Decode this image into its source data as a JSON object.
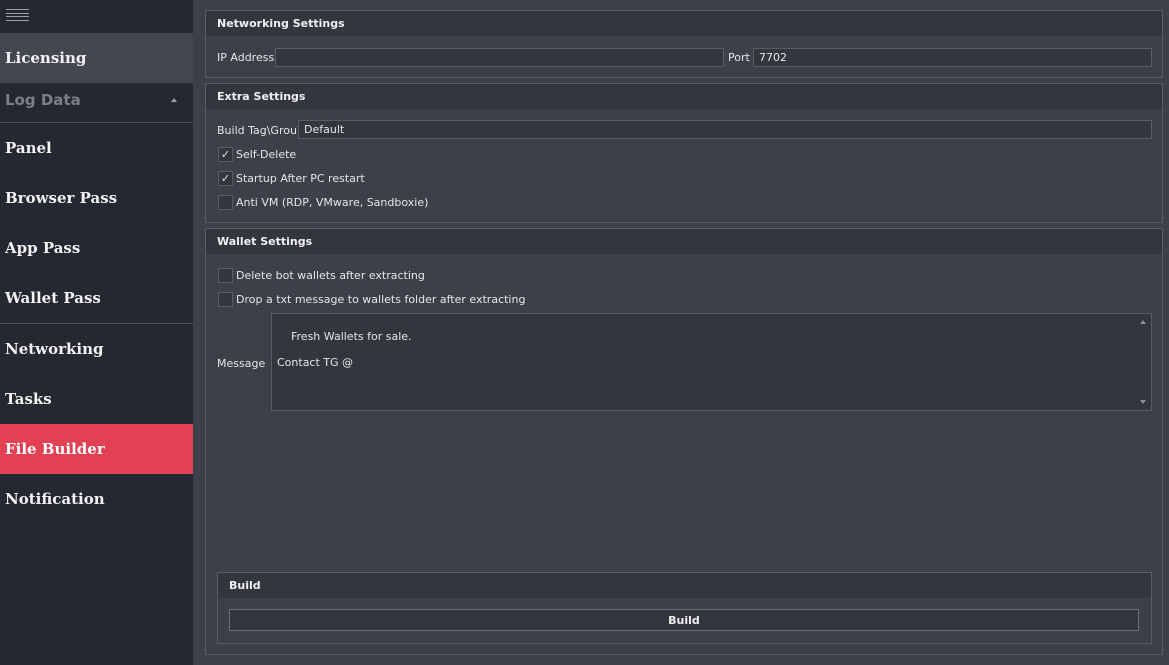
{
  "sidebar": {
    "items": [
      {
        "label": "Licensing"
      },
      {
        "label": "Log Data"
      },
      {
        "label": "Panel"
      },
      {
        "label": "Browser Pass"
      },
      {
        "label": "App Pass"
      },
      {
        "label": "Wallet Pass"
      },
      {
        "label": "Networking"
      },
      {
        "label": "Tasks"
      },
      {
        "label": "File Builder"
      },
      {
        "label": "Notification"
      }
    ],
    "active_color": "#e14152"
  },
  "networking": {
    "title": "Networking Settings",
    "ip_label": "IP Address",
    "ip_value": "",
    "port_label": "Port",
    "port_value": "7702"
  },
  "extra": {
    "title": "Extra Settings",
    "tag_label": "Build Tag\\Group",
    "tag_value": "Default",
    "self_delete": {
      "label": "Self-Delete",
      "mark": "✓"
    },
    "startup": {
      "label": "Startup After PC restart",
      "mark": "✓"
    },
    "anti_vm": {
      "label": "Anti VM (RDP, VMware, Sandboxie)",
      "mark": ""
    }
  },
  "wallet": {
    "title": "Wallet Settings",
    "delete_wallets": {
      "label": "Delete bot wallets after extracting",
      "mark": ""
    },
    "drop_txt": {
      "label": "Drop a txt message to wallets folder after extracting",
      "mark": ""
    },
    "message_label": "Message",
    "message_value": "Fresh Wallets for sale.\n\nContact TG @"
  },
  "build": {
    "title": "Build",
    "button_label": "Build"
  }
}
